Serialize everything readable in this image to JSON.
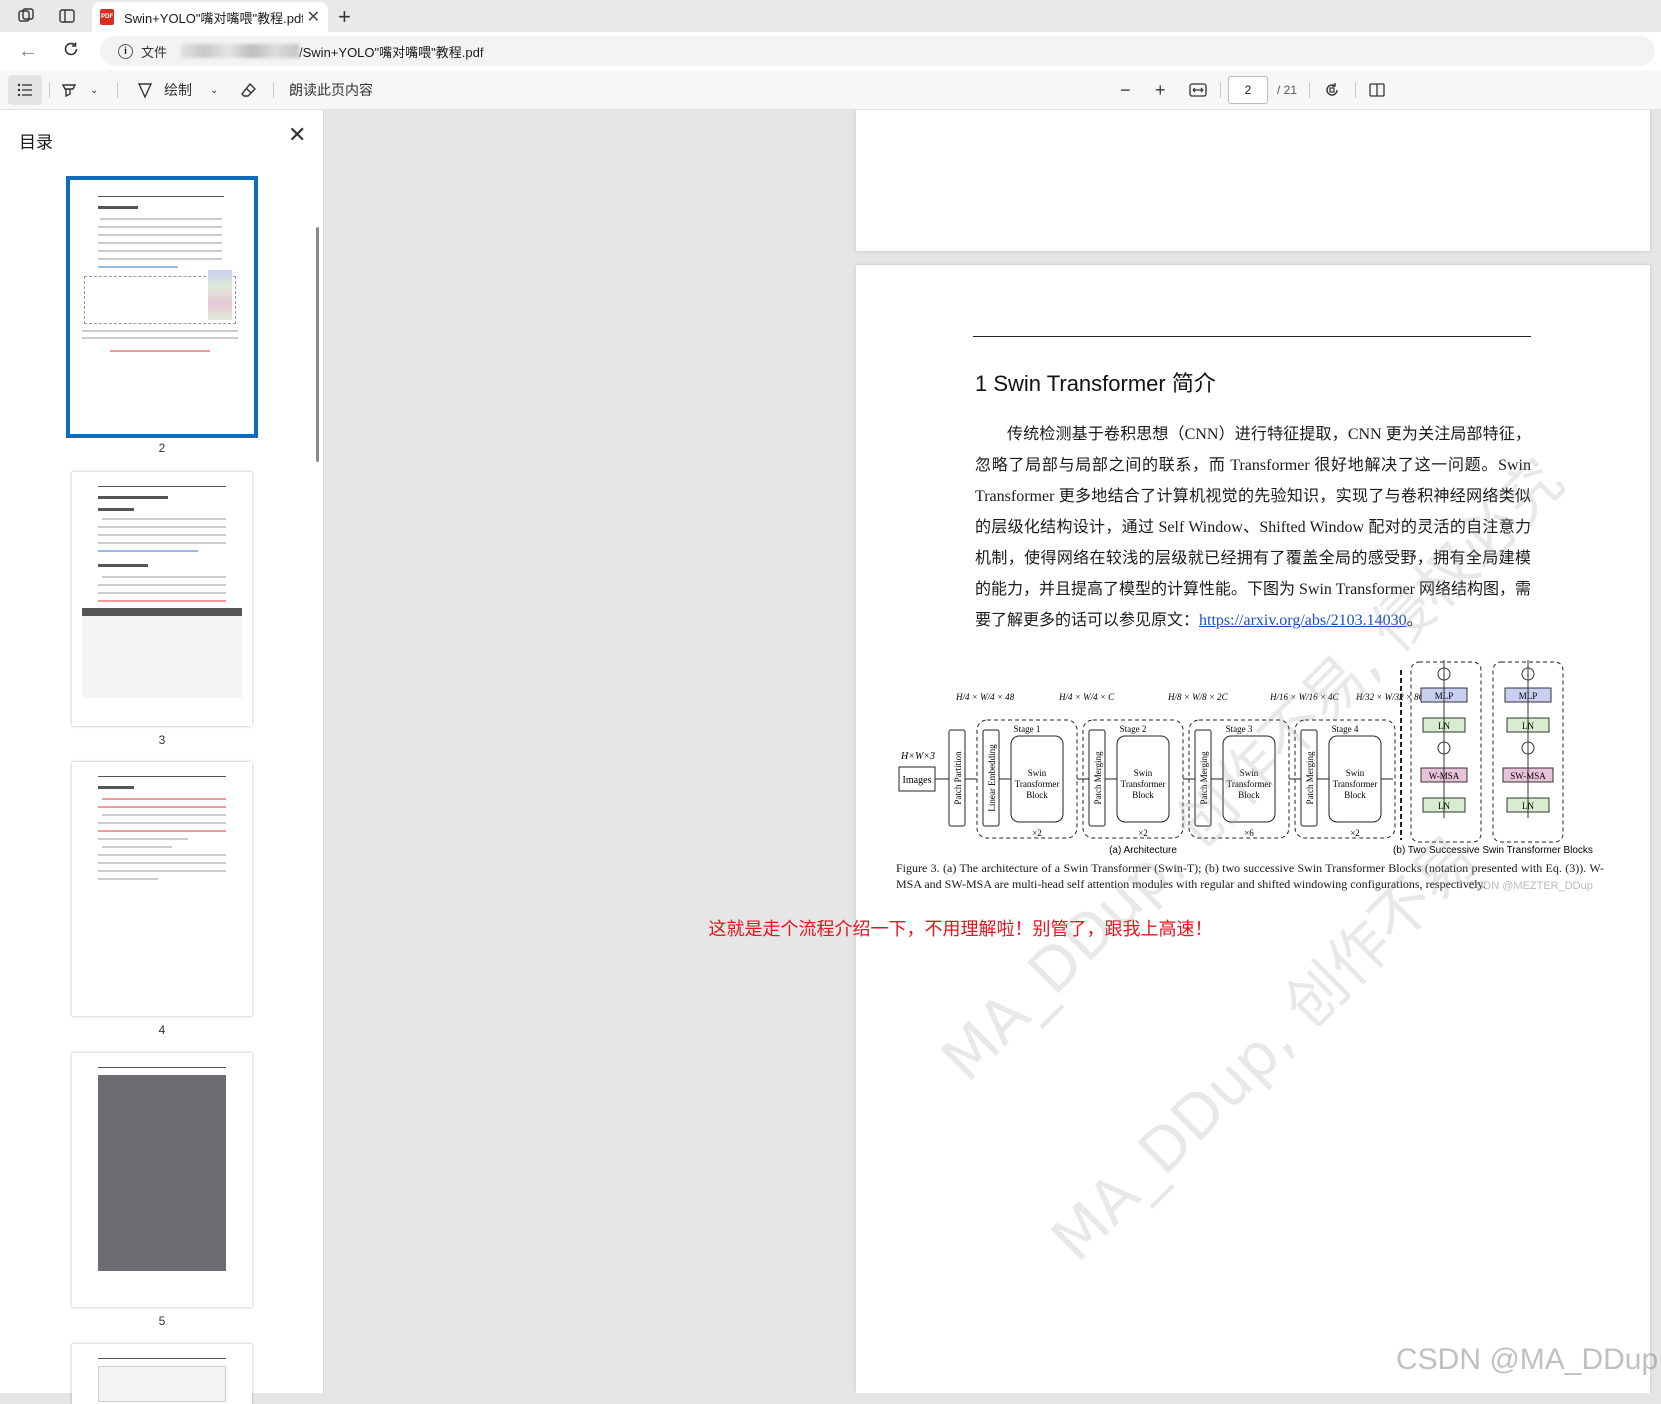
{
  "browser": {
    "tab_title": "Swin+YOLO\"嘴对嘴喂\"教程.pdf",
    "tab_icon": "pdf-icon",
    "address_label": "文件",
    "address_path": "/Swin+YOLO\"嘴对嘴喂\"教程.pdf"
  },
  "toolbar": {
    "draw_label": "绘制",
    "read_aloud_label": "朗读此页内容",
    "zoom_out": "−",
    "zoom_in": "+",
    "page_current": "2",
    "page_total": "/ 21"
  },
  "sidebar": {
    "title": "目录",
    "thumbnails": [
      {
        "page": "2",
        "selected": true
      },
      {
        "page": "3",
        "selected": false
      },
      {
        "page": "4",
        "selected": false
      },
      {
        "page": "5",
        "selected": false
      }
    ]
  },
  "document": {
    "heading": "1 Swin Transformer 简介",
    "paragraph": "传统检测基于卷积思想（CNN）进行特征提取，CNN 更为关注局部特征，忽略了局部与局部之间的联系，而 Transformer 很好地解决了这一问题。Swin Transformer 更多地结合了计算机视觉的先验知识，实现了与卷积神经网络类似的层级化结构设计，通过 Self Window、Shifted Window 配对的灵活的自注意力机制，使得网络在较浅的层级就已经拥有了覆盖全局的感受野，拥有全局建模的能力，并且提高了模型的计算性能。下图为 Swin Transformer 网络结构图，需要了解更多的话可以参见原文：",
    "link": "https://arxiv.org/abs/2103.14030",
    "paragraph_end": "。",
    "figure": {
      "input_size": "H×W×3",
      "images_label": "Images",
      "patch_partition": "Patch Partition",
      "linear_embedding": "Linear Embedding",
      "patch_merging": "Patch Merging",
      "block_label": "Swin Transformer Block",
      "stages": [
        "Stage 1",
        "Stage 2",
        "Stage 3",
        "Stage 4"
      ],
      "dims": [
        "H/4 × W/4 × 48",
        "H/4 × W/4 × C",
        "H/8 × W/8 × 2C",
        "H/16 × W/16 × 4C",
        "H/32 × W/32 × 8C"
      ],
      "repeats": [
        "×2",
        "×2",
        "×6",
        "×2"
      ],
      "sub_a": "(a) Architecture",
      "sub_b": "(b) Two Successive Swin Transformer Blocks",
      "mlp": "MLP",
      "ln": "LN",
      "wmsa": "W-MSA",
      "swmsa": "SW-MSA",
      "caption": "Figure 3. (a) The architecture of a Swin Transformer (Swin-T); (b) two successive Swin Transformer Blocks (notation presented with Eq. (3)). W-MSA and SW-MSA are multi-head self attention modules with regular and shifted windowing configurations, respectively.",
      "fig_watermark": "CSDN @MEZTER_DDup"
    },
    "red_note": "这就是走个流程介绍一下，不用理解啦！别管了，跟我上高速！",
    "watermark_1": "MA_DDup, 创作不易, 侵权必究",
    "watermark_2": "MA_DDup, 创作不易",
    "csdn_watermark": "CSDN @MA_DDup"
  }
}
